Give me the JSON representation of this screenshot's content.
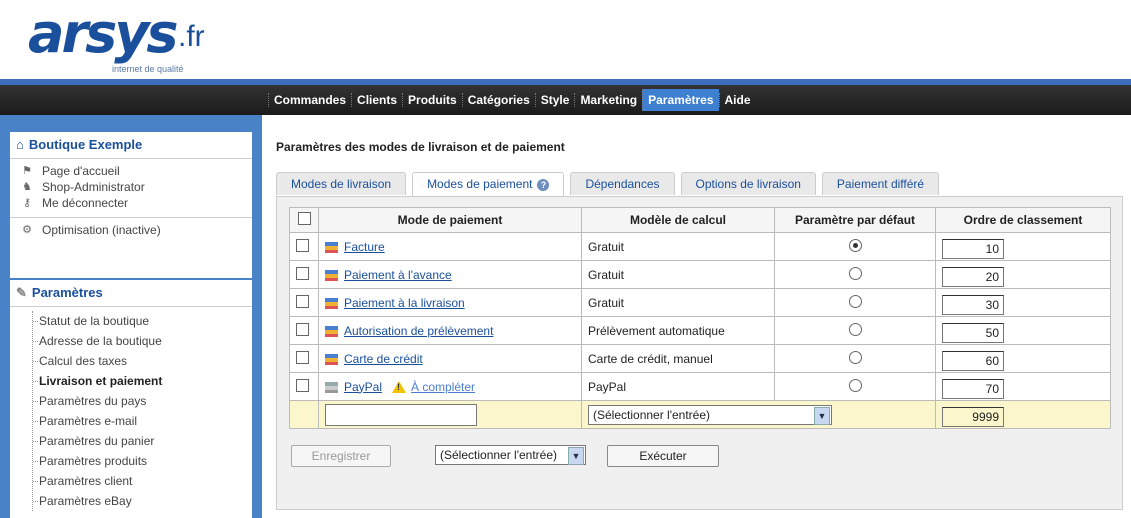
{
  "logo": {
    "brand": "arsys",
    "tld": ".fr",
    "tagline": "internet de qualité"
  },
  "topnav": [
    "Commandes",
    "Clients",
    "Produits",
    "Catégories",
    "Style",
    "Marketing",
    "Paramètres",
    "Aide"
  ],
  "sidebar": {
    "shop_box": {
      "title": "Boutique Exemple",
      "links": [
        "Page d'accueil",
        "Shop-Administrator",
        "Me déconnecter"
      ],
      "optimisation": "Optimisation (inactive)"
    },
    "params_box": {
      "title": "Paramètres",
      "links": [
        "Statut de la boutique",
        "Adresse de la boutique",
        "Calcul des taxes",
        "Livraison et paiement",
        "Paramètres du pays",
        "Paramètres e-mail",
        "Paramètres du panier",
        "Paramètres produits",
        "Paramètres client",
        "Paramètres eBay"
      ]
    }
  },
  "page": {
    "title": "Paramètres des modes de livraison et de paiement"
  },
  "tabs": [
    "Modes de livraison",
    "Modes de paiement",
    "Dépendances",
    "Options de livraison",
    "Paiement différé"
  ],
  "table": {
    "headers": [
      "Mode de paiement",
      "Modèle de calcul",
      "Paramètre par défaut",
      "Ordre de classement"
    ],
    "rows": [
      {
        "name": "Facture",
        "model": "Gratuit",
        "order": "10"
      },
      {
        "name": "Paiement à l'avance",
        "model": "Gratuit",
        "order": "20"
      },
      {
        "name": "Paiement à la livraison",
        "model": "Gratuit",
        "order": "30"
      },
      {
        "name": "Autorisation de prélèvement",
        "model": "Prélèvement automatique",
        "order": "50"
      },
      {
        "name": "Carte de crédit",
        "model": "Carte de crédit, manuel",
        "order": "60"
      },
      {
        "name": "PayPal",
        "model": "PayPal",
        "order": "70",
        "warning": "À compléter"
      }
    ],
    "new_row": {
      "select": "(Sélectionner l'entrée)",
      "order": "9999"
    }
  },
  "footer": {
    "save": "Enregistrer",
    "select": "(Sélectionner l'entrée)",
    "execute": "Exécuter"
  }
}
